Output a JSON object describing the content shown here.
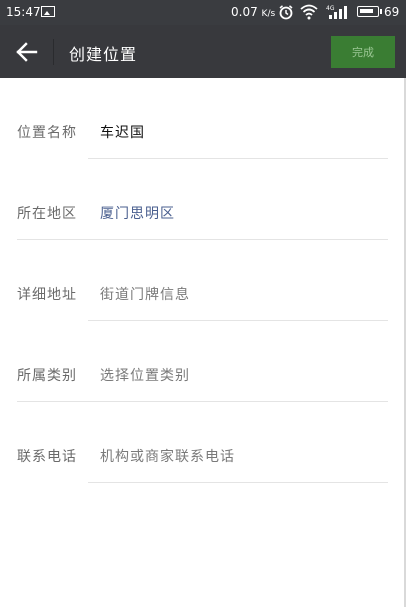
{
  "status": {
    "time": "15:47",
    "speed": "0.07",
    "speed_unit": "K/s",
    "network": "4G",
    "battery": "69"
  },
  "toolbar": {
    "title": "创建位置",
    "done_label": "完成"
  },
  "form": {
    "rows": [
      {
        "label": "位置名称",
        "value": "车迟国"
      },
      {
        "label": "所在地区",
        "value": "厦门思明区"
      },
      {
        "label": "详细地址",
        "value": "街道门牌信息"
      },
      {
        "label": "所属类别",
        "value": "选择位置类别"
      },
      {
        "label": "联系电话",
        "value": "机构或商家联系电话"
      }
    ]
  },
  "colors": {
    "toolbar_bg": "#38393d",
    "done_button_bg": "#3a7d33",
    "link_text": "#4a5f8f"
  }
}
